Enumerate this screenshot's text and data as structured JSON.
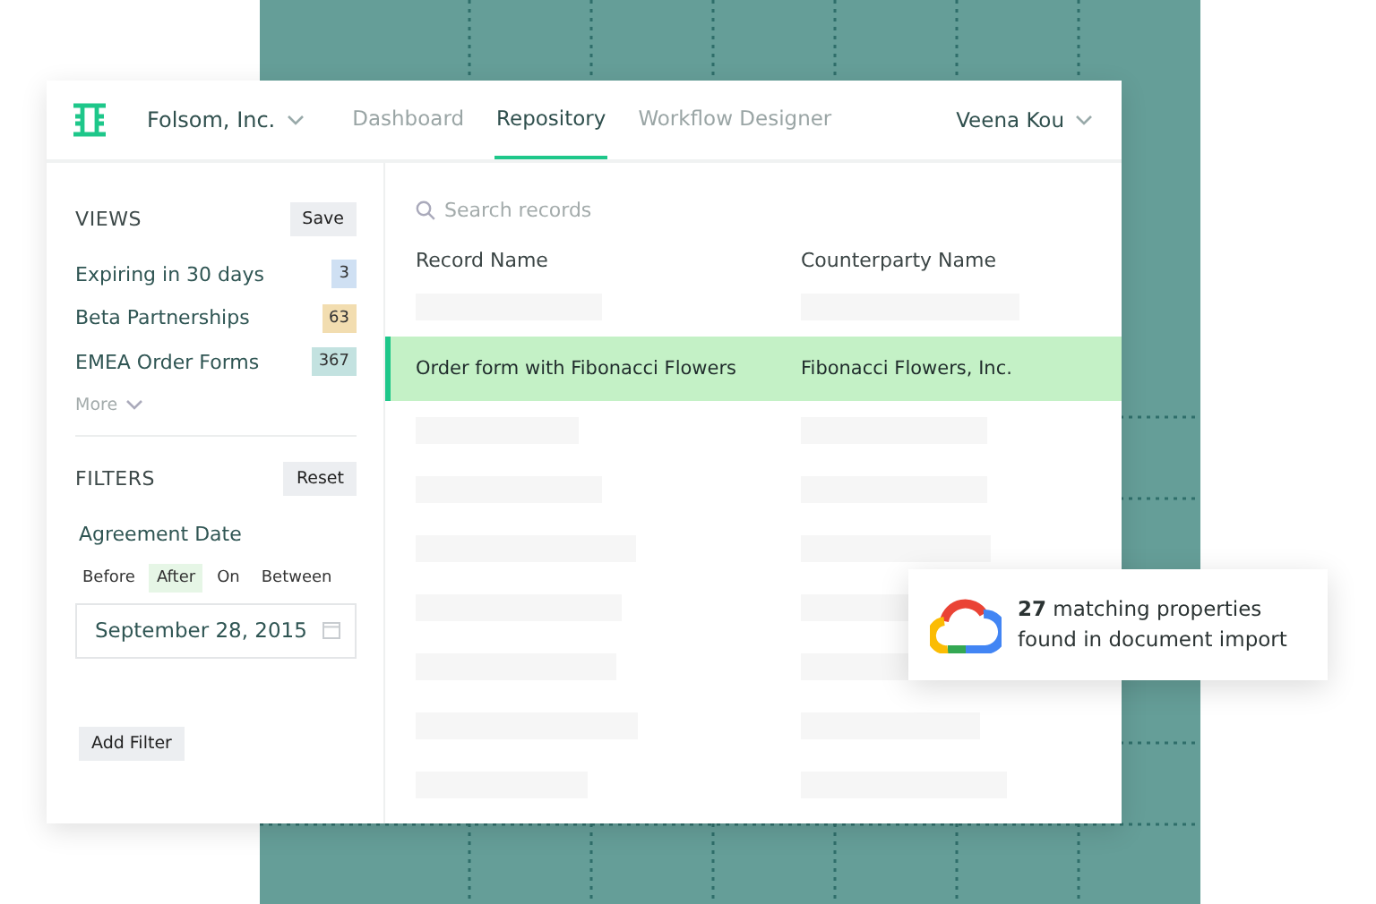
{
  "header": {
    "org": "Folsom, Inc.",
    "tabs": [
      {
        "label": "Dashboard",
        "selected": false
      },
      {
        "label": "Repository",
        "selected": true
      },
      {
        "label": "Workflow Designer",
        "selected": false
      }
    ],
    "user": "Veena Kou"
  },
  "views": {
    "title": "VIEWS",
    "save": "Save",
    "items": [
      {
        "label": "Expiring in 30 days",
        "count": "3",
        "color": "#cfe0f3"
      },
      {
        "label": "Beta Partnerships",
        "count": "63",
        "color": "#f2ddb0"
      },
      {
        "label": "EMEA Order Forms",
        "count": "367",
        "color": "#c3e2e0"
      }
    ],
    "more": "More"
  },
  "filters": {
    "title": "FILTERS",
    "reset": "Reset",
    "field": "Agreement Date",
    "options": [
      {
        "label": "Before",
        "selected": false
      },
      {
        "label": "After",
        "selected": true
      },
      {
        "label": "On",
        "selected": false
      },
      {
        "label": "Between",
        "selected": false
      }
    ],
    "date": "September 28, 2015",
    "add": "Add Filter"
  },
  "search": {
    "placeholder": "Search records"
  },
  "table": {
    "columns": [
      "Record Name",
      "Counterparty Name"
    ],
    "rows": [
      {
        "kind": "placeholder"
      },
      {
        "kind": "record",
        "cells": [
          "Order form with Fibonacci Flowers",
          "Fibonacci Flowers, Inc."
        ],
        "selected": true
      },
      {
        "kind": "placeholder"
      },
      {
        "kind": "placeholder"
      },
      {
        "kind": "placeholder"
      },
      {
        "kind": "placeholder"
      },
      {
        "kind": "placeholder"
      },
      {
        "kind": "placeholder"
      },
      {
        "kind": "placeholder"
      }
    ]
  },
  "toast": {
    "text": "**27** matching properties found in document import"
  }
}
